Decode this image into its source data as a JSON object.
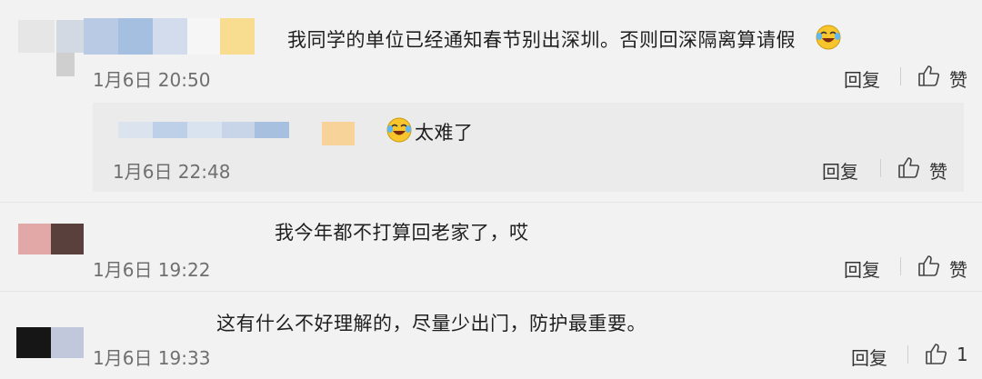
{
  "comments": [
    {
      "text": "我同学的单位已经通知春节别出深圳。否则回深隔离算请假",
      "time": "1月6日 20:50",
      "reply_label": "回复",
      "like_label": "赞",
      "reply": {
        "text": "太难了",
        "time": "1月6日 22:48",
        "reply_label": "回复",
        "like_label": "赞"
      }
    },
    {
      "text": "我今年都不打算回老家了，哎",
      "time": "1月6日 19:22",
      "reply_label": "回复",
      "like_label": "赞"
    },
    {
      "text": "这有什么不好理解的，尽量少出门，防护最重要。",
      "time": "1月6日 19:33",
      "reply_label": "回复",
      "like_label": "1"
    }
  ],
  "colors": {
    "background": "#f2f2f2",
    "reply_background": "#ebebeb",
    "time_text": "#6f6f6f",
    "comment_text": "#1f1f1f"
  },
  "icons": [
    "thumbs-up-icon",
    "laughing-crying-emoji-icon"
  ]
}
